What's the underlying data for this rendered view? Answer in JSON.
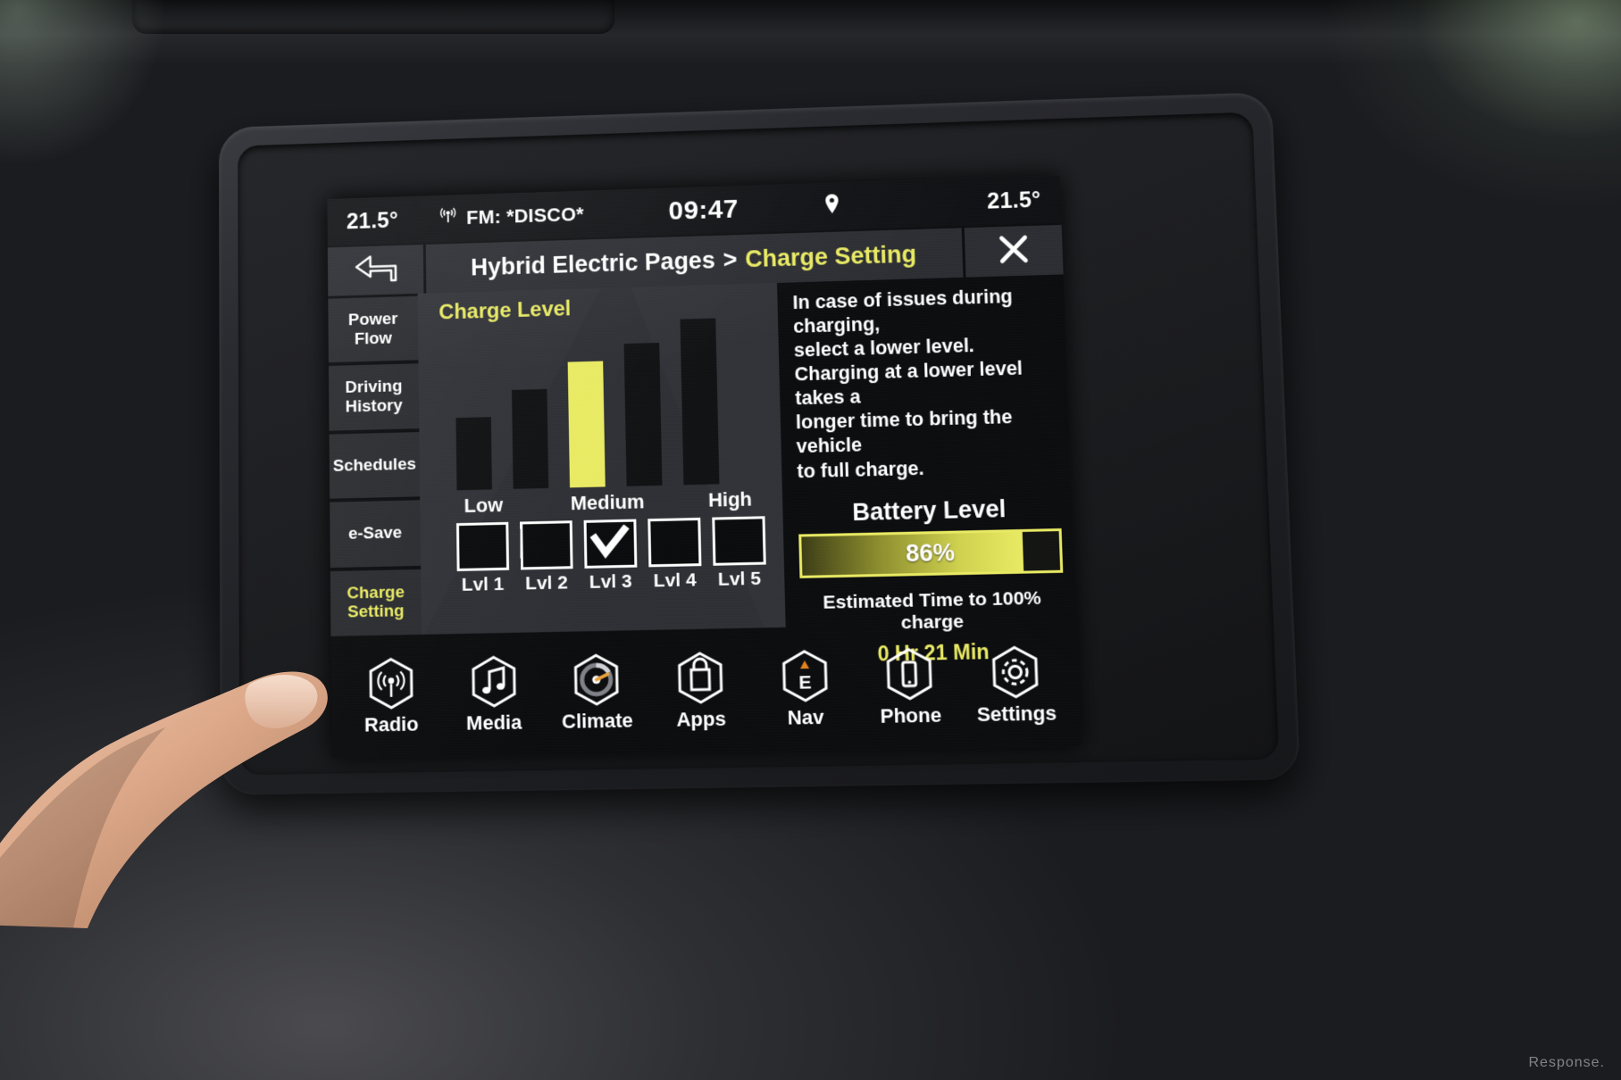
{
  "statusbar": {
    "temp_left": "21.5°",
    "radio_icon": "radio-signal-icon",
    "radio_source": "FM: *DISCO*",
    "clock": "09:47",
    "location_icon": "map-pin-icon",
    "temp_right": "21.5°"
  },
  "titlebar": {
    "back_icon": "back-arrow-icon",
    "crumb_parent": "Hybrid Electric Pages",
    "crumb_separator": ">",
    "crumb_current": "Charge Setting",
    "close_icon": "close-x-icon"
  },
  "sidebar": {
    "items": [
      {
        "label": "Power Flow",
        "active": false
      },
      {
        "label": "Driving History",
        "active": false
      },
      {
        "label": "Schedules",
        "active": false
      },
      {
        "label": "e-Save",
        "active": false
      },
      {
        "label": "Charge Setting",
        "active": true
      }
    ]
  },
  "charge_level": {
    "title": "Charge Level",
    "scale_labels": [
      "Low",
      "Medium",
      "High"
    ],
    "selected_index": 2,
    "levels": [
      {
        "label": "Lvl 1",
        "checked": false
      },
      {
        "label": "Lvl 2",
        "checked": false
      },
      {
        "label": "Lvl 3",
        "checked": true
      },
      {
        "label": "Lvl 4",
        "checked": false
      },
      {
        "label": "Lvl 5",
        "checked": false
      }
    ],
    "check_glyph": "✔"
  },
  "info": {
    "line1": "In case of issues during charging,",
    "line2": "select a lower level.",
    "line3": "Charging at a lower level takes a",
    "line4": "longer time to bring the vehicle",
    "line5": "to full charge."
  },
  "battery": {
    "title": "Battery Level",
    "percent_label": "86%",
    "percent_value": 86,
    "estimate_title": "Estimated Time to 100% charge",
    "estimate_value": "0 Hr 21 Min"
  },
  "navbar": {
    "items": [
      {
        "label": "Radio",
        "icon": "radio-tower-icon"
      },
      {
        "label": "Media",
        "icon": "music-note-icon"
      },
      {
        "label": "Climate",
        "icon": "climate-fan-icon"
      },
      {
        "label": "Apps",
        "icon": "apps-box-icon"
      },
      {
        "label": "Nav",
        "icon": "nav-compass-icon"
      },
      {
        "label": "Phone",
        "icon": "phone-icon"
      },
      {
        "label": "Settings",
        "icon": "gear-icon"
      }
    ]
  },
  "colors": {
    "accent_yellow": "#e9ea63",
    "screen_bg": "#0c0d0f",
    "panel_bg": "#2e3035",
    "tile_bg": "#2b2d31",
    "bar_dark": "#111214"
  },
  "watermark": "Response.",
  "chart_data": {
    "type": "bar",
    "title": "Charge Level",
    "categories": [
      "Lvl 1",
      "Lvl 2",
      "Lvl 3",
      "Lvl 4",
      "Lvl 5"
    ],
    "values": [
      44,
      60,
      76,
      86,
      100
    ],
    "axis_tick_labels": [
      "Low",
      "Medium",
      "High"
    ],
    "highlighted_category": "Lvl 3",
    "highlight_color": "#e9ea63",
    "bar_color": "#111214",
    "xlabel": "",
    "ylabel": "",
    "ylim": [
      0,
      100
    ],
    "grid": false,
    "legend": "none"
  }
}
